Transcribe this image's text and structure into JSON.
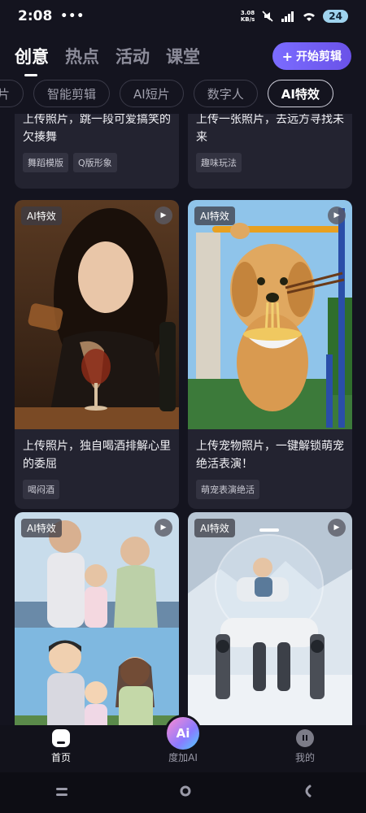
{
  "status": {
    "time": "2:08",
    "dots": "•••",
    "net_speed": "3.08",
    "net_unit": "KB/s",
    "battery": "24"
  },
  "topnav": {
    "tabs": [
      {
        "label": "创意",
        "active": true
      },
      {
        "label": "热点",
        "active": false
      },
      {
        "label": "活动",
        "active": false
      },
      {
        "label": "课堂",
        "active": false
      }
    ],
    "start_button": "开始剪辑"
  },
  "chips": [
    "片",
    "智能剪辑",
    "AI短片",
    "数字人",
    "AI特效"
  ],
  "cards": [
    {
      "title": "上传照片，跳一段可爱搞笑的欠揍舞",
      "tags": [
        "舞蹈模版",
        "Q版形象"
      ]
    },
    {
      "title": "上传一张照片，去远方寻找未来",
      "tags": [
        "趣味玩法"
      ]
    },
    {
      "badge": "AI特效",
      "title": "上传照片，独自喝酒排解心里的委屈",
      "tags": [
        "喝闷酒"
      ]
    },
    {
      "badge": "AI特效",
      "title": "上传宠物照片，一键解锁萌宠绝活表演！",
      "tags": [
        "萌宠表演绝活"
      ]
    },
    {
      "badge": "AI特效"
    },
    {
      "badge": "AI特效"
    }
  ],
  "bottomnav": {
    "home": "首页",
    "ai": "度加AI",
    "me": "我的",
    "ai_icon": "Ai"
  }
}
